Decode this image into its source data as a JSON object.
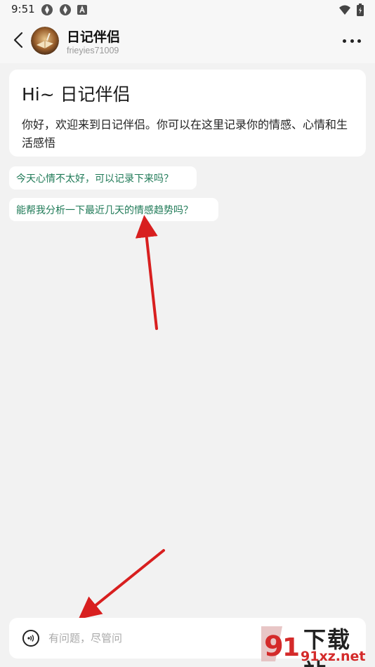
{
  "status_bar": {
    "time": "9:51",
    "icons_left": [
      "aperture-icon",
      "aperture-icon",
      "app-a-icon"
    ],
    "icons_right": [
      "wifi-icon",
      "battery-icon"
    ]
  },
  "header": {
    "title": "日记伴侣",
    "subtitle": "frieyies71009",
    "back_icon": "chevron-left-icon",
    "more_icon": "more-horizontal-icon"
  },
  "welcome": {
    "title": "Hi~ 日记伴侣",
    "text": "你好，欢迎来到日记伴侣。你可以在这里记录你的情感、心情和生活感悟"
  },
  "suggestions": [
    "今天心情不太好，可以记录下来吗？",
    "能帮我分析一下最近几天的情感趋势吗？"
  ],
  "input": {
    "placeholder": "有问题，尽管问",
    "voice_icon": "voice-icon"
  },
  "watermark": {
    "top": "下载站",
    "bottom": "91xz.net"
  },
  "colors": {
    "suggestion_text": "#1f7a57",
    "annotation_arrow": "#d81f1f",
    "background": "#f2f2f2"
  }
}
